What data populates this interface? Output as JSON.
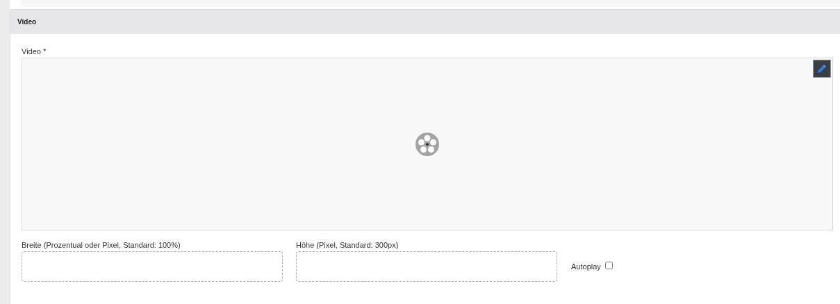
{
  "panel": {
    "title": "Video"
  },
  "video_field": {
    "label": "Video *"
  },
  "fields": [
    {
      "label": "Breite (Prozentual oder Pixel, Standard: 100%)"
    },
    {
      "label": "Höhe (Pixel, Standard: 300px)"
    }
  ],
  "autoplay": {
    "label": "Autoplay",
    "checked": false
  }
}
